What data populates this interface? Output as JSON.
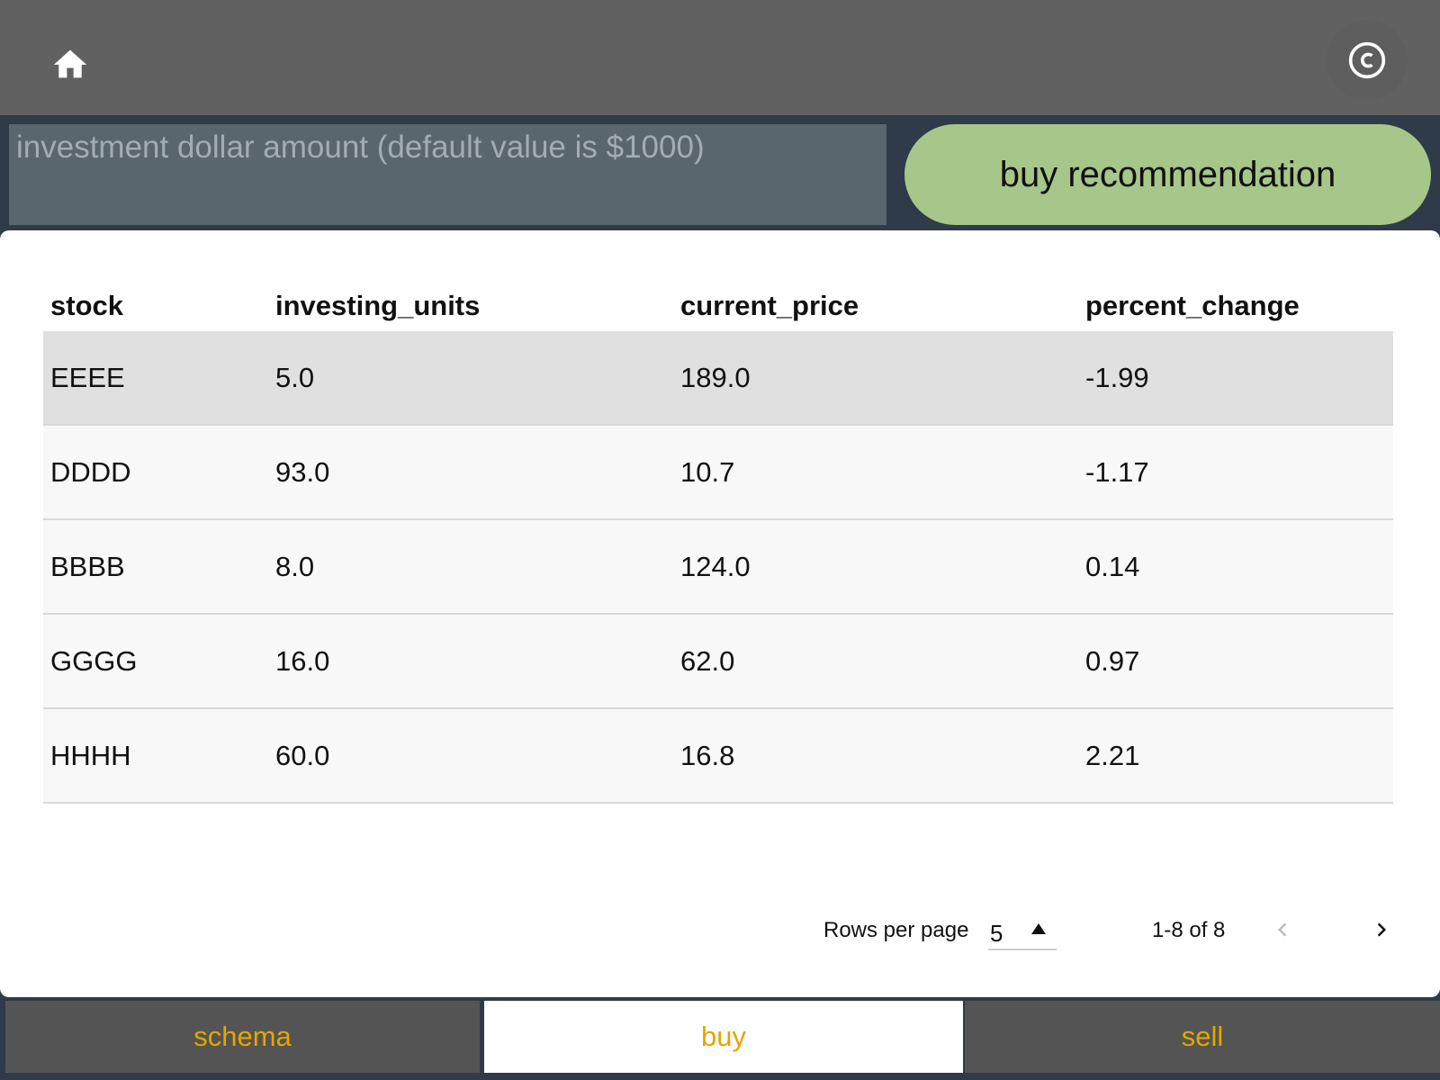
{
  "header": {
    "home_icon": "home-icon",
    "copyright_icon": "copyright-icon"
  },
  "investment": {
    "placeholder": "investment dollar amount (default value is $1000)",
    "value": "",
    "button_label": "buy recommendation"
  },
  "table": {
    "columns": [
      "stock",
      "investing_units",
      "current_price",
      "percent_change"
    ],
    "rows": [
      [
        "EEEE",
        "5.0",
        "189.0",
        "-1.99"
      ],
      [
        "DDDD",
        "93.0",
        "10.7",
        "-1.17"
      ],
      [
        "BBBB",
        "8.0",
        "124.0",
        "0.14"
      ],
      [
        "GGGG",
        "16.0",
        "62.0",
        "0.97"
      ],
      [
        "HHHH",
        "60.0",
        "16.8",
        "2.21"
      ]
    ]
  },
  "pagination": {
    "rows_per_page_label": "Rows per page",
    "rows_per_page_value": "5",
    "range_text": "1-8 of 8",
    "prev_icon": "chevron-left-icon",
    "next_icon": "chevron-right-icon"
  },
  "tabs": [
    {
      "label": "schema"
    },
    {
      "label": "buy"
    },
    {
      "label": "sell"
    }
  ],
  "colors": {
    "topbar": "#616161",
    "background": "#2f3b48",
    "input_bg": "#59666e",
    "button_bg": "#a7c68a",
    "tab_text": "#e3a600",
    "selected_row": "#e0e0e0"
  }
}
